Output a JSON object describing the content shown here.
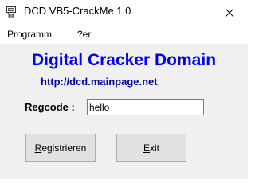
{
  "window": {
    "title": "DCD VB5-CrackMe 1.0",
    "icon": "app-icon",
    "close_glyph": "✕"
  },
  "menu": {
    "items": [
      {
        "label": "Programm"
      },
      {
        "label": "?er"
      }
    ]
  },
  "main": {
    "heading": "Digital Cracker Domain",
    "url": "http://dcd.mainpage.net",
    "heading_color": "#0000ff",
    "url_color": "#0000aa"
  },
  "form": {
    "regcode_label": "Regcode :",
    "regcode_value": "hello"
  },
  "buttons": {
    "register": {
      "accel": "R",
      "rest": "egistrieren"
    },
    "exit": {
      "accel": "E",
      "rest": "xit"
    }
  }
}
